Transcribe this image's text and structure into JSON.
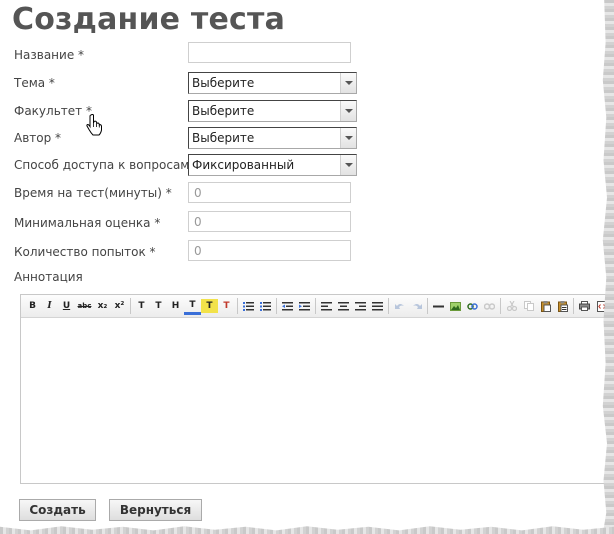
{
  "page_title": "Создание теста",
  "form": {
    "name": {
      "label": "Название *",
      "value": ""
    },
    "topic": {
      "label": "Тема *",
      "selected": "Выберите"
    },
    "faculty": {
      "label": "Факультет *",
      "selected": "Выберите"
    },
    "author": {
      "label": "Автор *",
      "selected": "Выберите"
    },
    "access": {
      "label": "Способ доступа к вопросам *",
      "selected": "Фиксированный"
    },
    "time": {
      "label": "Время на тест(минуты) *",
      "value": "0"
    },
    "min_score": {
      "label": "Минимальная оценка *",
      "value": "0"
    },
    "attempts": {
      "label": "Количество попыток *",
      "value": "0"
    },
    "annotation": {
      "label": "Аннотация"
    }
  },
  "toolbar": {
    "bold": "B",
    "italic": "I",
    "underline": "U",
    "strike": "abc",
    "subscript": "x₂",
    "superscript": "x²",
    "font_size": "T",
    "font_family": "T",
    "heading": "H",
    "text_color": "T",
    "highlight": "T",
    "clear_format": "T"
  },
  "buttons": {
    "create": "Создать",
    "back": "Вернуться"
  },
  "colors": {
    "title": "#555555",
    "label": "#444444",
    "border": "#cfcfcf"
  }
}
